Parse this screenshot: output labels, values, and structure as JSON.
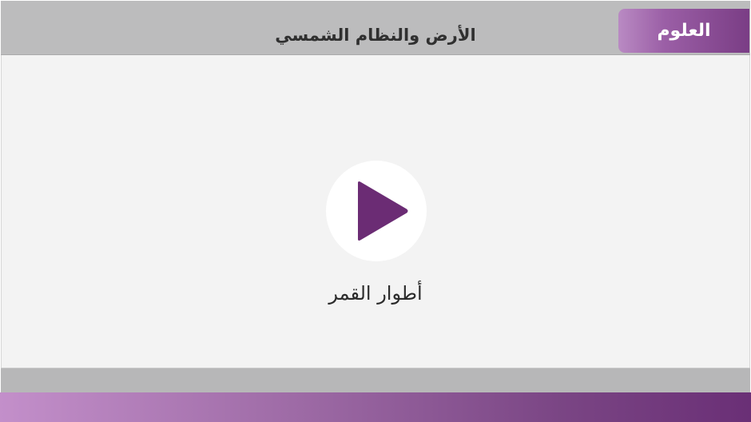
{
  "header": {
    "subject_label": "العلوم",
    "title": "الأرض والنظام الشمسي"
  },
  "video": {
    "caption": "أطوار القمر",
    "play_icon": "play-icon"
  },
  "colors": {
    "accent": "#6b2c74",
    "header_bg": "#bcbcbd",
    "content_bg": "#f3f3f3"
  }
}
